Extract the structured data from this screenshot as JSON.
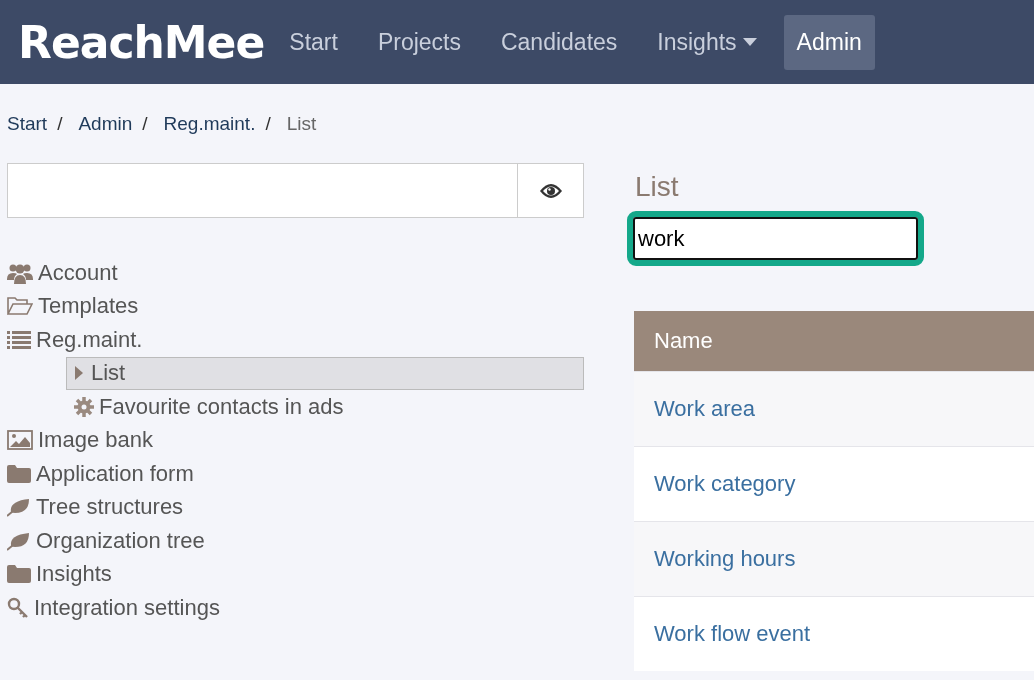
{
  "header": {
    "logo": "ReachMee",
    "nav": [
      {
        "label": "Start",
        "selected": false,
        "dropdown": false
      },
      {
        "label": "Projects",
        "selected": false,
        "dropdown": false
      },
      {
        "label": "Candidates",
        "selected": false,
        "dropdown": false
      },
      {
        "label": "Insights",
        "selected": false,
        "dropdown": true
      },
      {
        "label": "Admin",
        "selected": true,
        "dropdown": false
      }
    ]
  },
  "breadcrumb": {
    "separator": "/",
    "items": [
      {
        "label": "Start",
        "current": false
      },
      {
        "label": "Admin",
        "current": false
      },
      {
        "label": "Reg.maint.",
        "current": false
      },
      {
        "label": "List",
        "current": true
      }
    ]
  },
  "sidebar": {
    "items": [
      {
        "label": "Account",
        "selected": false
      },
      {
        "label": "Templates",
        "selected": false
      },
      {
        "label": "Reg.maint.",
        "selected": false,
        "children": [
          {
            "label": "List",
            "selected": true
          },
          {
            "label": "Favourite contacts in ads",
            "selected": false
          }
        ]
      },
      {
        "label": "Image bank",
        "selected": false
      },
      {
        "label": "Application form",
        "selected": false
      },
      {
        "label": "Tree structures",
        "selected": false
      },
      {
        "label": "Organization tree",
        "selected": false
      },
      {
        "label": "Insights",
        "selected": false
      },
      {
        "label": "Integration settings",
        "selected": false
      }
    ]
  },
  "main": {
    "title": "List",
    "filter": {
      "value": "work"
    },
    "table": {
      "columns": [
        "Name"
      ],
      "rows": [
        [
          "Work area"
        ],
        [
          "Work category"
        ],
        [
          "Working hours"
        ],
        [
          "Work flow event"
        ]
      ]
    }
  }
}
